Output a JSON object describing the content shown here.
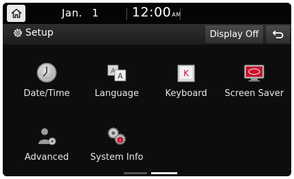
{
  "status_bar": {
    "month": "Jan.",
    "day": "1",
    "time": "12:00",
    "ampm": "AM"
  },
  "title_bar": {
    "title": "Setup",
    "display_off_label": "Display Off"
  },
  "menu": {
    "items": [
      {
        "label": "Date/Time",
        "icon": "clock-icon"
      },
      {
        "label": "Language",
        "icon": "language-icon"
      },
      {
        "label": "Keyboard",
        "icon": "keyboard-icon"
      },
      {
        "label": "Screen Saver",
        "icon": "screen-saver-icon"
      },
      {
        "label": "Advanced",
        "icon": "advanced-icon"
      },
      {
        "label": "System Info",
        "icon": "system-info-icon"
      }
    ]
  },
  "pager": {
    "pages": 2,
    "current": 2
  },
  "colors": {
    "background": "#111111",
    "title_bar": "#262626",
    "button": "#3c3c3c",
    "brand_red": "#c8102e"
  }
}
